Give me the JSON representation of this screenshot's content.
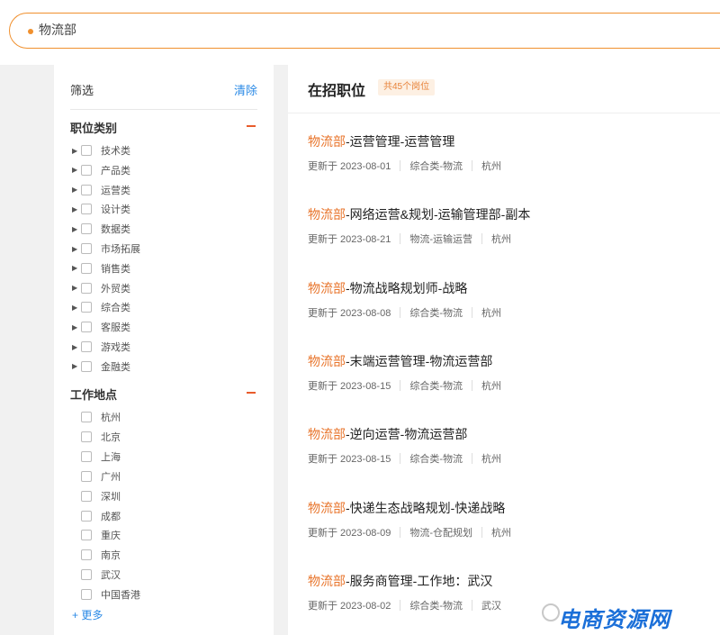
{
  "search": {
    "value": "物流部"
  },
  "sidebar": {
    "filter_title": "筛选",
    "clear_label": "清除",
    "category_group": {
      "title": "职位类别",
      "items": [
        "技术类",
        "产品类",
        "运营类",
        "设计类",
        "数据类",
        "市场拓展",
        "销售类",
        "外贸类",
        "综合类",
        "客服类",
        "游戏类",
        "金融类"
      ]
    },
    "location_group": {
      "title": "工作地点",
      "items": [
        "杭州",
        "北京",
        "上海",
        "广州",
        "深圳",
        "成都",
        "重庆",
        "南京",
        "武汉",
        "中国香港"
      ]
    },
    "more_label": "+ 更多"
  },
  "main": {
    "title": "在招职位",
    "count_badge": "共45个岗位",
    "jobs": [
      {
        "highlight": "物流部",
        "rest": "-运营管理-运营管理",
        "date": "更新于 2023-08-01",
        "category": "综合类-物流",
        "city": "杭州"
      },
      {
        "highlight": "物流部",
        "rest": "-网络运营&规划-运输管理部-副本",
        "date": "更新于 2023-08-21",
        "category": "物流-运输运营",
        "city": "杭州"
      },
      {
        "highlight": "物流部",
        "rest": "-物流战略规划师-战略",
        "date": "更新于 2023-08-08",
        "category": "综合类-物流",
        "city": "杭州"
      },
      {
        "highlight": "物流部",
        "rest": "-末端运营管理-物流运营部",
        "date": "更新于 2023-08-15",
        "category": "综合类-物流",
        "city": "杭州"
      },
      {
        "highlight": "物流部",
        "rest": "-逆向运营-物流运营部",
        "date": "更新于 2023-08-15",
        "category": "综合类-物流",
        "city": "杭州"
      },
      {
        "highlight": "物流部",
        "rest": "-快递生态战略规划-快递战略",
        "date": "更新于 2023-08-09",
        "category": "物流-仓配规划",
        "city": "杭州"
      },
      {
        "highlight": "物流部",
        "rest": "-服务商管理-工作地：武汉",
        "date": "更新于 2023-08-02",
        "category": "综合类-物流",
        "city": "武汉"
      }
    ]
  },
  "watermark": {
    "text": "电商资源网"
  },
  "colors": {
    "accent": "#e8752c",
    "link": "#2b8ae6",
    "search_border": "#f0902e"
  }
}
